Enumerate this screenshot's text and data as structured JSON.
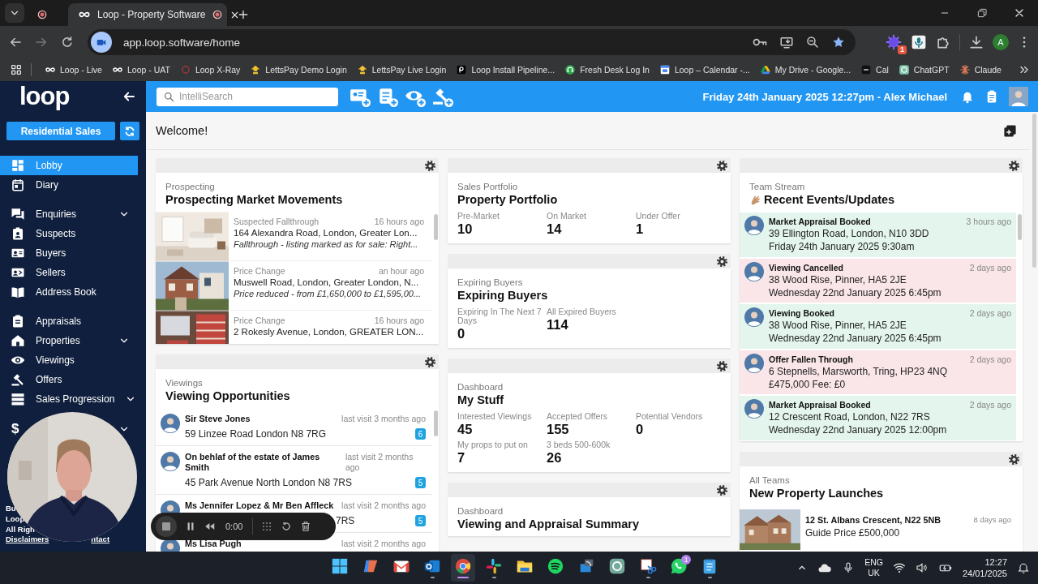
{
  "browser": {
    "tab_title": "Loop - Property Software",
    "address": "app.loop.software/home",
    "extension_badge": "1",
    "profile_initial": "A",
    "bookmarks": [
      {
        "label": "Loop - Live"
      },
      {
        "label": "Loop - UAT"
      },
      {
        "label": "Loop X-Ray"
      },
      {
        "label": "LettsPay Demo Login"
      },
      {
        "label": "LettsPay Live Login"
      },
      {
        "label": "Loop Install Pipeline..."
      },
      {
        "label": "Fresh Desk Log In"
      },
      {
        "label": "Loop – Calendar -..."
      },
      {
        "label": "My Drive - Google..."
      },
      {
        "label": "Cal"
      },
      {
        "label": "ChatGPT"
      },
      {
        "label": "Claude"
      }
    ]
  },
  "app": {
    "logo": "loop",
    "department": "Residential Sales",
    "nav_groups": [
      {
        "items": [
          {
            "label": "Lobby",
            "selected": true,
            "expandable": false
          },
          {
            "label": "Diary",
            "selected": false,
            "expandable": false
          }
        ]
      },
      {
        "items": [
          {
            "label": "Enquiries",
            "selected": false,
            "expandable": true
          },
          {
            "label": "Suspects",
            "selected": false,
            "expandable": false
          },
          {
            "label": "Buyers",
            "selected": false,
            "expandable": false
          },
          {
            "label": "Sellers",
            "selected": false,
            "expandable": false
          },
          {
            "label": "Address Book",
            "selected": false,
            "expandable": false
          }
        ]
      },
      {
        "items": [
          {
            "label": "Appraisals",
            "selected": false,
            "expandable": false
          },
          {
            "label": "Properties",
            "selected": false,
            "expandable": true
          },
          {
            "label": "Viewings",
            "selected": false,
            "expandable": false
          },
          {
            "label": "Offers",
            "selected": false,
            "expandable": false
          },
          {
            "label": "Sales Progression",
            "selected": false,
            "expandable": true
          }
        ]
      }
    ],
    "covered_nav_item": {
      "glyph": "$",
      "expandable": true
    },
    "footer_lines": [
      "Bu",
      "Loop",
      "All Righ"
    ],
    "footer_links": [
      "Disclaimers",
      "ntact"
    ],
    "search": {
      "placeholder": "IntelliSearch"
    },
    "header_info": "Friday 24th January 2025 12:27pm - Alex Michael",
    "welcome": "Welcome!",
    "columns": [
      {
        "widgets": [
          {
            "kind": "feed",
            "subtitle": "Prospecting",
            "title": "Prospecting Market Movements",
            "rows": [
              {
                "type": "Suspected Fallthrough",
                "time": "16 hours ago",
                "address": "164 Alexandra Road, London, Greater Lon...",
                "note": "Fallthrough - listing marked as for sale: Right..."
              },
              {
                "type": "Price Change",
                "time": "an hour ago",
                "address": "Muswell Road, London, Greater London, N...",
                "note": "Price reduced - from £1,650,000 to £1,595,00..."
              },
              {
                "type": "Price Change",
                "time": "16 hours ago",
                "address": "2 Rokesly Avenue, London, GREATER LON..."
              }
            ]
          },
          {
            "kind": "people",
            "subtitle": "Viewings",
            "title": "Viewing Opportunities",
            "rows": [
              {
                "name": "Sir Steve Jones",
                "time": "last visit 3 months ago",
                "address": "59 Linzee Road London N8 7RG",
                "count": "6"
              },
              {
                "name": "On behlaf of the estate of James Smith",
                "time": "last visit 2 months ago",
                "address": "45 Park Avenue North London N8 7RS",
                "count": "5"
              },
              {
                "name": "Ms Jennifer Lopez & Mr Ben Affleck",
                "time": "last visit 2 months ago",
                "address": "7RS",
                "address_covered": true,
                "count": "5"
              },
              {
                "name": "Ms Lisa Pugh",
                "time": "last visit 2 months ago"
              }
            ]
          }
        ]
      },
      {
        "widgets": [
          {
            "kind": "stats",
            "subtitle": "Sales Portfolio",
            "title": "Property Portfolio",
            "stats": [
              {
                "label": "Pre-Market",
                "value": "10"
              },
              {
                "label": "On Market",
                "value": "14"
              },
              {
                "label": "Under Offer",
                "value": "1"
              }
            ]
          },
          {
            "kind": "stats",
            "subtitle": "Expiring Buyers",
            "title": "Expiring Buyers",
            "stats": [
              {
                "label": "Expiring In The Next 7 Days",
                "value": "0"
              },
              {
                "label": "All Expired Buyers",
                "value": "114"
              }
            ]
          },
          {
            "kind": "stats",
            "subtitle": "Dashboard",
            "title": "My Stuff",
            "stats": [
              {
                "label": "Interested Viewings",
                "value": "45"
              },
              {
                "label": "Accepted Offers",
                "value": "155"
              },
              {
                "label": "Potential Vendors",
                "value": "0"
              },
              {
                "label": "My props to put on",
                "value": "7"
              },
              {
                "label": "3 beds 500-600k",
                "value": "26"
              }
            ]
          },
          {
            "kind": "stats",
            "subtitle": "Dashboard",
            "title": "Viewing and Appraisal Summary"
          }
        ]
      },
      {
        "widgets": [
          {
            "kind": "stream",
            "subtitle": "Team Stream",
            "title": "Recent Events/Updates",
            "rows": [
              {
                "event": "Market Appraisal Booked",
                "time": "3 hours ago",
                "lines": [
                  "39 Ellington Road, London, N10 3DD",
                  "Friday 24th January 2025 9:30am"
                ],
                "color": "#e3f5ec"
              },
              {
                "event": "Viewing Cancelled",
                "time": "2 days ago",
                "lines": [
                  "38 Wood Rise, Pinner, HA5 2JE",
                  "Wednesday 22nd January 2025 6:45pm"
                ],
                "color": "#fae6e9"
              },
              {
                "event": "Viewing Booked",
                "time": "2 days ago",
                "lines": [
                  "38 Wood Rise, Pinner, HA5 2JE",
                  "Wednesday 22nd January 2025 6:45pm"
                ],
                "color": "#e3f5ec"
              },
              {
                "event": "Offer Fallen Through",
                "time": "2 days ago",
                "lines": [
                  "6 Stepnells, Marsworth, Tring, HP23 4NQ",
                  "£475,000 Fee: £0"
                ],
                "color": "#fae6e9"
              },
              {
                "event": "Market Appraisal Booked",
                "time": "2 days ago",
                "lines": [
                  "12 Crescent Road, London, N22 7RS",
                  "Wednesday 22nd January 2025 12:00pm"
                ],
                "color": "#e3f5ec"
              }
            ]
          },
          {
            "kind": "launches",
            "subtitle": "All Teams",
            "title": "New Property Launches",
            "rows": [
              {
                "address": "12 St. Albans Crescent, N22 5NB",
                "price": "Guide Price £500,000",
                "time": "8 days ago"
              }
            ]
          }
        ]
      }
    ]
  },
  "recorder": {
    "time": "0:00"
  },
  "taskbar": {
    "apps": [
      {
        "selected": false,
        "running": false
      },
      {
        "selected": false,
        "running": false
      },
      {
        "selected": false,
        "running": false
      },
      {
        "selected": false,
        "running": true
      },
      {
        "selected": true,
        "running": true
      },
      {
        "selected": false,
        "running": true
      },
      {
        "selected": false,
        "running": false
      },
      {
        "selected": false,
        "running": false
      },
      {
        "selected": false,
        "running": false
      },
      {
        "selected": false,
        "running": false
      },
      {
        "selected": false,
        "running": true
      },
      {
        "selected": false,
        "running": false,
        "badge": "1"
      },
      {
        "selected": false,
        "running": true
      }
    ],
    "language": [
      "ENG",
      "UK"
    ],
    "time": "12:27",
    "date": "24/01/2025"
  }
}
